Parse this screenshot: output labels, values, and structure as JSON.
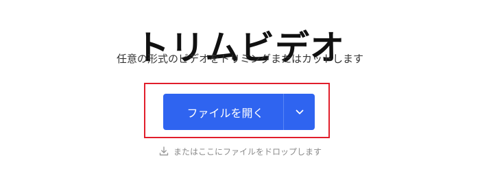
{
  "page": {
    "title": "トリムビデオ",
    "subtitle": "任意の形式のビデオをトリミングまたはカットします"
  },
  "actions": {
    "open_file_label": "ファイルを開く",
    "dropdown_icon": "chevron-down-icon",
    "accent_color": "#2f64f0"
  },
  "drop_hint": {
    "icon": "download-icon",
    "text": "またはここにファイルをドロップします"
  },
  "highlight": {
    "color": "#e11d2a"
  }
}
